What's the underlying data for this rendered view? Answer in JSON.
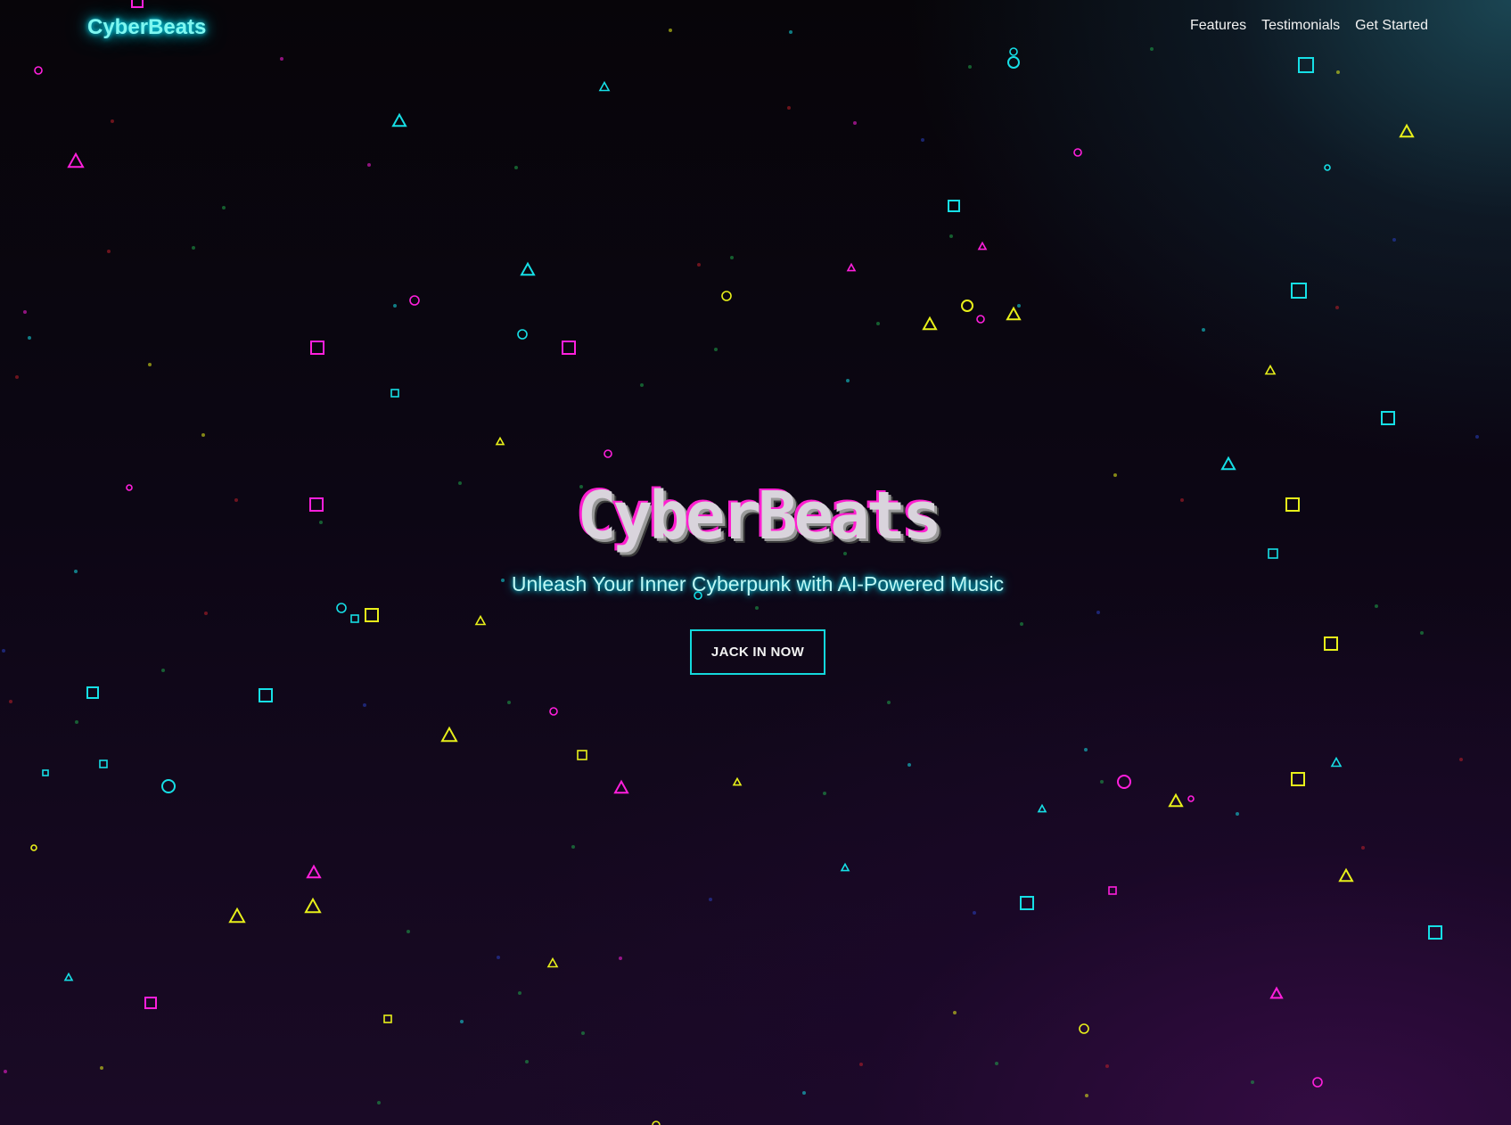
{
  "header": {
    "brand": "CyberBeats",
    "nav": [
      {
        "label": "Features"
      },
      {
        "label": "Testimonials"
      },
      {
        "label": "Get Started"
      }
    ]
  },
  "hero": {
    "title": "CyberBeats",
    "subtitle": "Unleash Your Inner Cyberpunk with AI-Powered Music",
    "cta_label": "JACK IN NOW"
  },
  "colors": {
    "cyan": "#16dfe6",
    "magenta": "#ff1fdc",
    "yellow": "#e8f01a",
    "green": "#1fa84a",
    "red": "#c0202a",
    "blue": "#2a40c0"
  }
}
